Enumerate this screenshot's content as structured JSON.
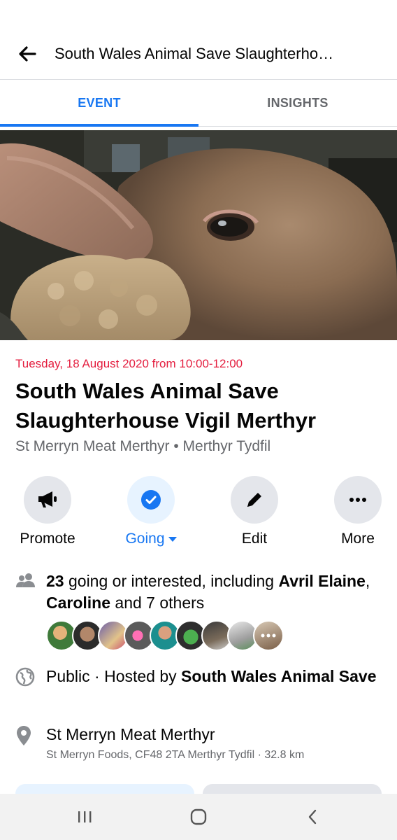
{
  "header": {
    "title": "South Wales Animal Save Slaughterho…"
  },
  "tabs": [
    {
      "label": "EVENT",
      "active": true
    },
    {
      "label": "INSIGHTS",
      "active": false
    }
  ],
  "event": {
    "date": "Tuesday, 18 August 2020 from 10:00-12:00",
    "title": "South Wales Animal Save Slaughterhouse Vigil Merthyr",
    "location_line": "St Merryn Meat Merthyr • Merthyr Tydfil"
  },
  "actions": [
    {
      "label": "Promote",
      "icon": "megaphone-icon"
    },
    {
      "label": "Going",
      "icon": "check-circle-icon",
      "active": true
    },
    {
      "label": "Edit",
      "icon": "pencil-icon"
    },
    {
      "label": "More",
      "icon": "more-dots-icon"
    }
  ],
  "attendance": {
    "count": "23",
    "text_1": " going or interested, including ",
    "name_1": "Avril Elaine",
    "sep": ", ",
    "name_2": "Caroline",
    "text_2": " and 7 others"
  },
  "privacy": {
    "text": "Public · Hosted by ",
    "host": "South Wales Animal Save"
  },
  "place": {
    "name": "St Merryn Meat Merthyr",
    "address": "St Merryn Foods, CF48 2TA Merthyr Tydfil · 32.8 km"
  },
  "colors": {
    "accent": "#1877f2",
    "date_red": "#e41e3f",
    "secondary_text": "#65676b"
  }
}
